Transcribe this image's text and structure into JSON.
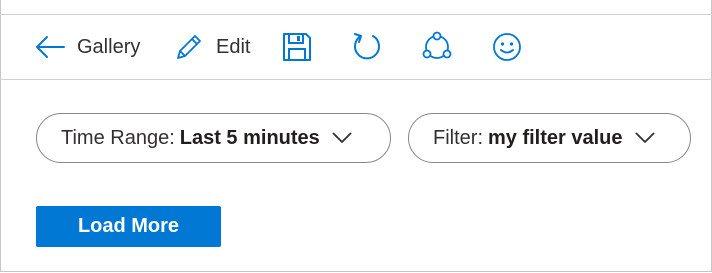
{
  "toolbar": {
    "back_label": "Gallery",
    "edit_label": "Edit",
    "icons": {
      "back": "arrow-left-icon",
      "edit": "pencil-icon",
      "save": "save-icon",
      "refresh": "refresh-icon",
      "share": "share-icon",
      "feedback": "smiley-icon"
    }
  },
  "parameters": {
    "time_range": {
      "label": "Time Range:",
      "value": "Last 5 minutes"
    },
    "filter": {
      "label": "Filter:",
      "value": "my filter value"
    }
  },
  "actions": {
    "load_more_label": "Load More"
  },
  "colors": {
    "accent": "#0078d4",
    "text": "#323130",
    "border": "#8a8886",
    "divider": "#d2d0ce",
    "button_text": "#ffffff"
  }
}
